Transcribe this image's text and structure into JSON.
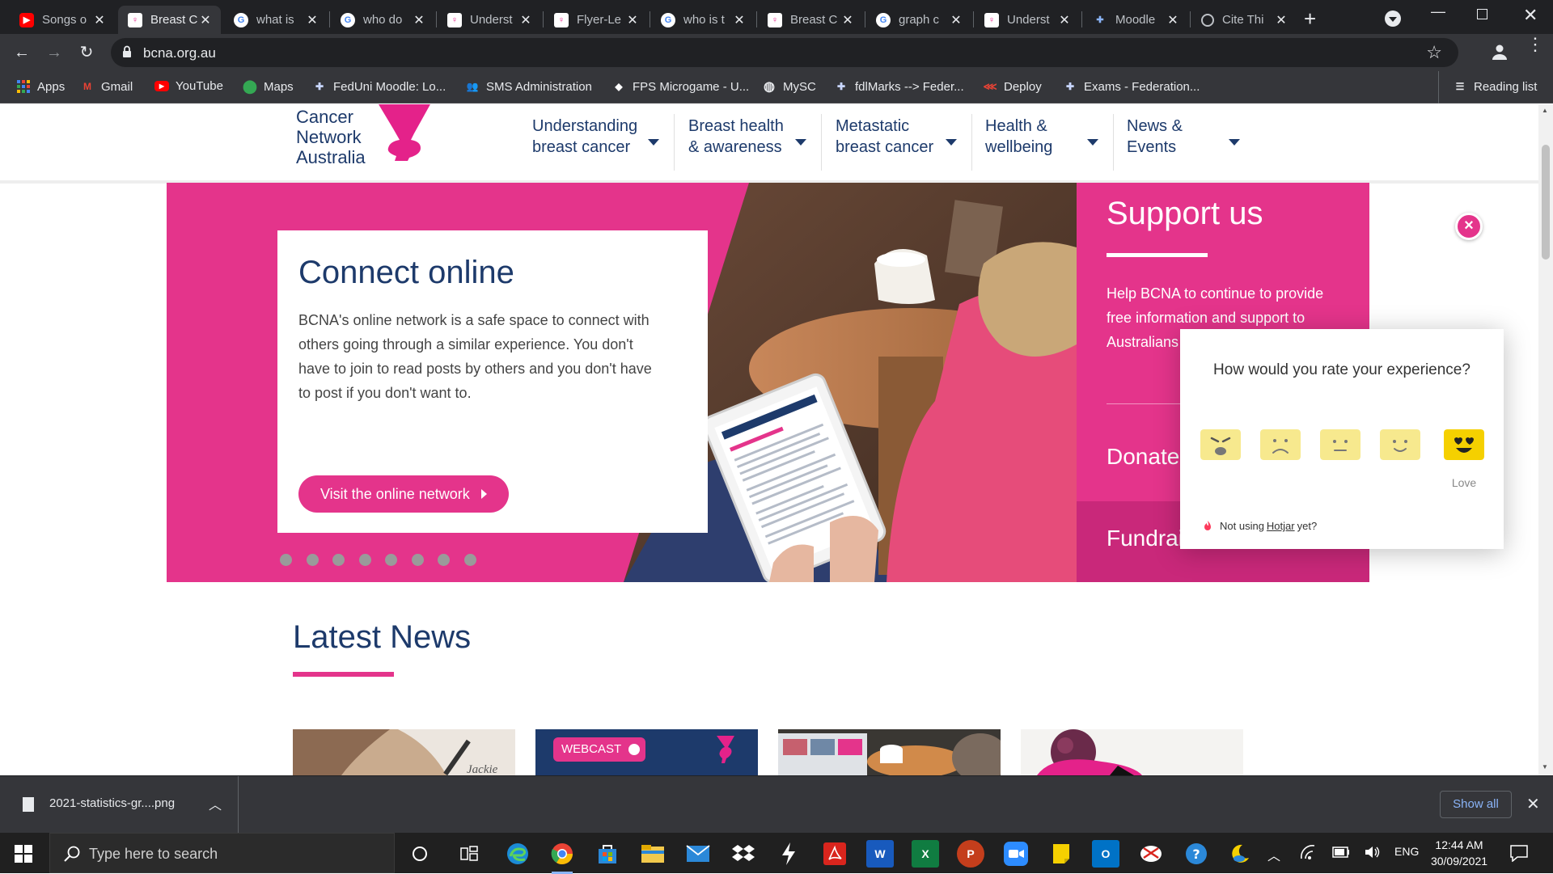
{
  "tabs": [
    {
      "title": "Songs o",
      "icon": "youtube-icon"
    },
    {
      "title": "Breast C",
      "icon": "bcna-icon",
      "active": true
    },
    {
      "title": "what is",
      "icon": "google-icon"
    },
    {
      "title": "who do",
      "icon": "google-icon"
    },
    {
      "title": "Underst",
      "icon": "bcna-icon"
    },
    {
      "title": "Flyer-Le",
      "icon": "bcna-icon"
    },
    {
      "title": "who is t",
      "icon": "google-icon"
    },
    {
      "title": "Breast C",
      "icon": "bcna-icon"
    },
    {
      "title": "graph c",
      "icon": "google-icon"
    },
    {
      "title": "Underst",
      "icon": "bcna-icon"
    },
    {
      "title": "Moodle",
      "icon": "federation-icon"
    },
    {
      "title": "Cite Thi",
      "icon": "globe-icon"
    }
  ],
  "address": {
    "url": "bcna.org.au"
  },
  "bookmarks": [
    {
      "label": "Apps",
      "icon": "apps-grid-icon"
    },
    {
      "label": "Gmail",
      "icon": "gmail-icon"
    },
    {
      "label": "YouTube",
      "icon": "youtube-icon"
    },
    {
      "label": "Maps",
      "icon": "maps-pin-icon"
    },
    {
      "label": "FedUni Moodle: Lo...",
      "icon": "federation-icon"
    },
    {
      "label": "SMS Administration",
      "icon": "people-icon"
    },
    {
      "label": "FPS Microgame - U...",
      "icon": "game-icon"
    },
    {
      "label": "MySC",
      "icon": "globe-icon"
    },
    {
      "label": "fdlMarks --> Feder...",
      "icon": "federation-icon"
    },
    {
      "label": "Deploy",
      "icon": "deploy-icon"
    },
    {
      "label": "Exams - Federation...",
      "icon": "federation-icon"
    }
  ],
  "reading_list": "Reading list",
  "site": {
    "logo_lines": [
      "Cancer",
      "Network",
      "Australia"
    ],
    "nav": [
      {
        "line1": "Understanding",
        "line2": "breast cancer"
      },
      {
        "line1": "Breast health",
        "line2": "& awareness"
      },
      {
        "line1": "Metastatic",
        "line2": "breast cancer"
      },
      {
        "line1": "Health &",
        "line2": "wellbeing"
      },
      {
        "line1": "News &",
        "line2": "Events"
      }
    ],
    "hero": {
      "title": "Connect online",
      "body": "BCNA's online network is a safe space to connect with others going through a similar experience. You don't have to join to read posts by others and you don't have to post if you don't want to.",
      "button": "Visit the online network",
      "slide_count": 8
    },
    "support": {
      "title": "Support us",
      "text": "Help BCNA to continue to provide free information and support to Australians affected by breast cancer",
      "donate": "Donate",
      "fundraise": "Fundraise"
    },
    "latest_news": "Latest News",
    "news_thumbs": [
      {
        "caption": "Jackie"
      },
      {
        "badge": "WEBCAST"
      },
      {
        "caption": ""
      },
      {
        "caption": ""
      }
    ]
  },
  "hotjar": {
    "question": "How would you rate your experience?",
    "ratings": [
      "Hate",
      "Dislike",
      "Neutral",
      "Like",
      "Love"
    ],
    "selected_label": "Love",
    "footer_prefix": "Not using",
    "footer_link": "Hotjar",
    "footer_suffix": "yet?"
  },
  "download": {
    "filename": "2021-statistics-gr....png",
    "show_all": "Show all"
  },
  "taskbar": {
    "search_placeholder": "Type here to search",
    "language": "ENG",
    "time": "12:44 AM",
    "date": "30/09/2021"
  },
  "colors": {
    "brand_pink": "#e4348b",
    "brand_navy": "#1d3a6b",
    "chrome_dark": "#202124"
  }
}
